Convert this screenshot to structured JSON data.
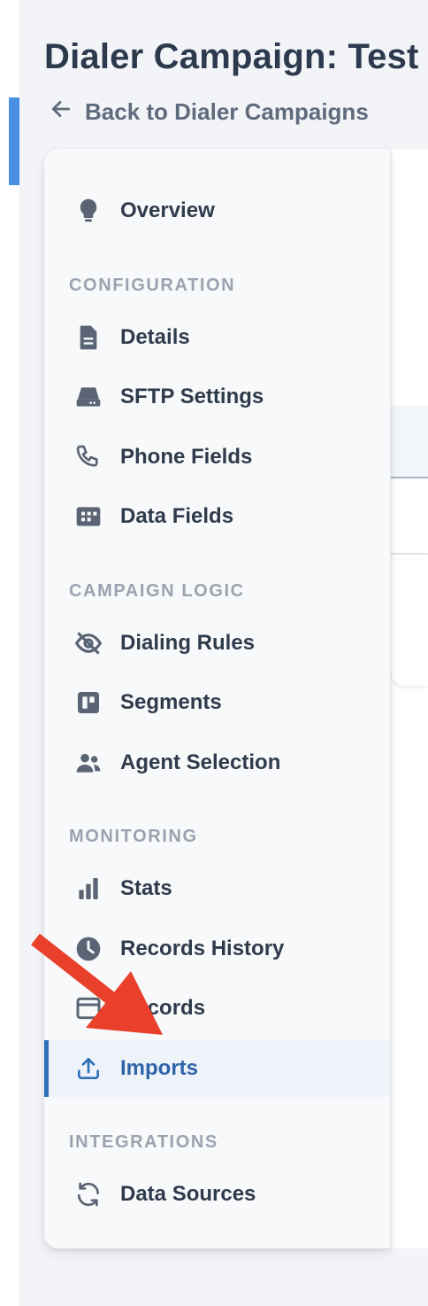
{
  "page": {
    "title": "Dialer Campaign: Test",
    "back_link": "Back to Dialer Campaigns"
  },
  "nav": {
    "overview": {
      "label": "Overview",
      "icon": "lightbulb-icon"
    },
    "sections": [
      {
        "header": "CONFIGURATION",
        "items": [
          {
            "label": "Details",
            "icon": "document-icon"
          },
          {
            "label": "SFTP Settings",
            "icon": "server-drive-icon"
          },
          {
            "label": "Phone Fields",
            "icon": "phone-icon"
          },
          {
            "label": "Data Fields",
            "icon": "data-grid-icon"
          }
        ]
      },
      {
        "header": "CAMPAIGN LOGIC",
        "items": [
          {
            "label": "Dialing Rules",
            "icon": "eye-slash-icon"
          },
          {
            "label": "Segments",
            "icon": "segments-board-icon"
          },
          {
            "label": "Agent Selection",
            "icon": "users-icon"
          }
        ]
      },
      {
        "header": "MONITORING",
        "items": [
          {
            "label": "Stats",
            "icon": "bar-chart-icon"
          },
          {
            "label": "Records History",
            "icon": "clock-icon"
          },
          {
            "label": "Records",
            "icon": "records-icon"
          },
          {
            "label": "Imports",
            "icon": "upload-icon",
            "active": true
          }
        ]
      },
      {
        "header": "INTEGRATIONS",
        "items": [
          {
            "label": "Data Sources",
            "icon": "refresh-icon"
          }
        ]
      }
    ]
  },
  "colors": {
    "accent": "#2f6fb8",
    "active_bg": "#eef3fa",
    "annotation_arrow": "#e8402a",
    "left_accent_bar": "#4a90e2"
  }
}
